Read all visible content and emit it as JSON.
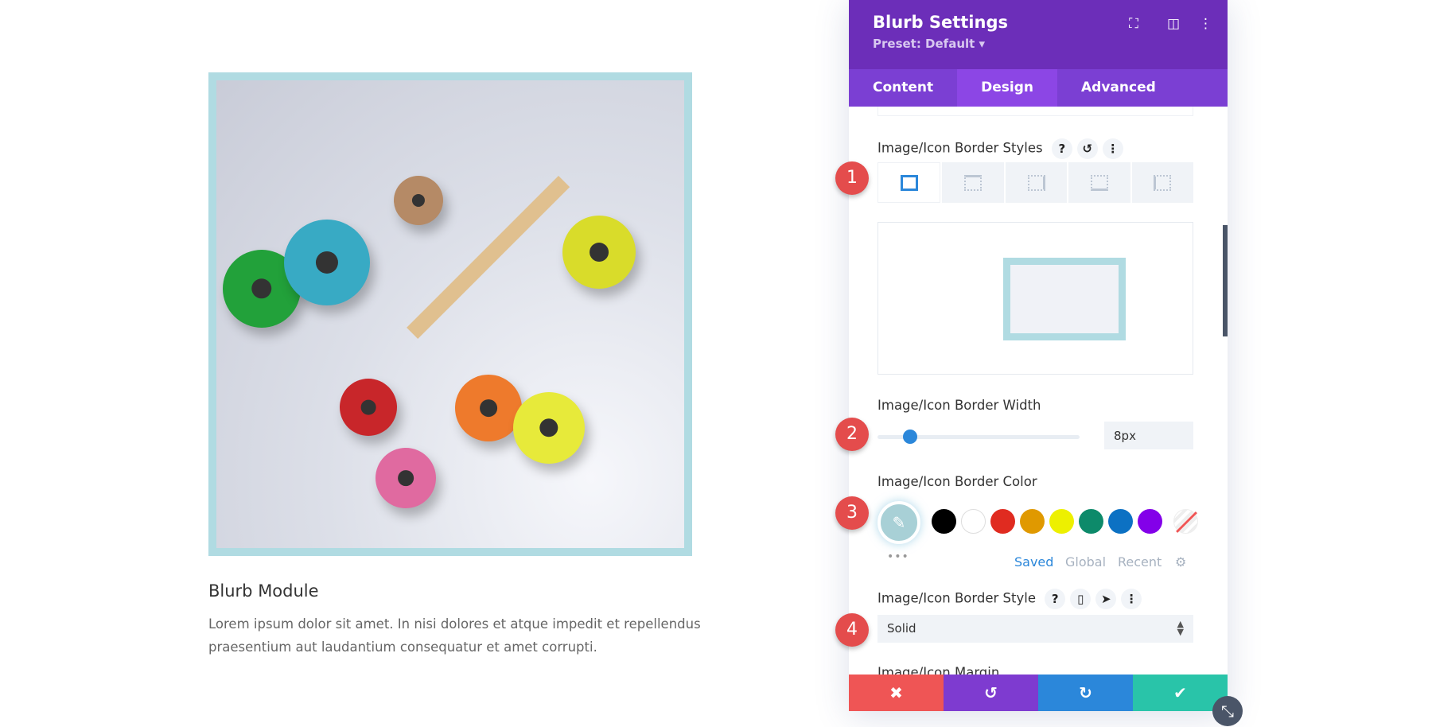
{
  "blurb": {
    "title": "Blurb Module",
    "text": "Lorem ipsum dolor sit amet. In nisi dolores et atque impedit et repellendus praesentium aut laudantium consequatur et amet corrupti."
  },
  "panel": {
    "title": "Blurb Settings",
    "preset": "Preset: Default ▾",
    "tabs": [
      {
        "label": "Content"
      },
      {
        "label": "Design"
      },
      {
        "label": "Advanced"
      }
    ],
    "border_styles_label": "Image/Icon Border Styles",
    "border_width_label": "Image/Icon Border Width",
    "border_width_value": "8px",
    "border_width_slider_fraction": 0.16,
    "border_color_label": "Image/Icon Border Color",
    "border_color": "#b0dbe2",
    "swatches": [
      "#000000",
      "#ffffff",
      "#e02b20",
      "#e09900",
      "#edf000",
      "#0d8a6a",
      "#0c71c3",
      "#8300e9"
    ],
    "palette_tabs": [
      "Saved",
      "Global",
      "Recent"
    ],
    "border_style_label": "Image/Icon Border Style",
    "border_style_value": "Solid",
    "margin_label": "Image/Icon Margin"
  },
  "badges": [
    "1",
    "2",
    "3",
    "4"
  ],
  "colors": {
    "header": "#6c2eb9",
    "tabs": "#7b3fd3",
    "cancel": "#ef5555",
    "undo": "#7e3bd0",
    "redo": "#2b87da",
    "save": "#29c4a9"
  }
}
